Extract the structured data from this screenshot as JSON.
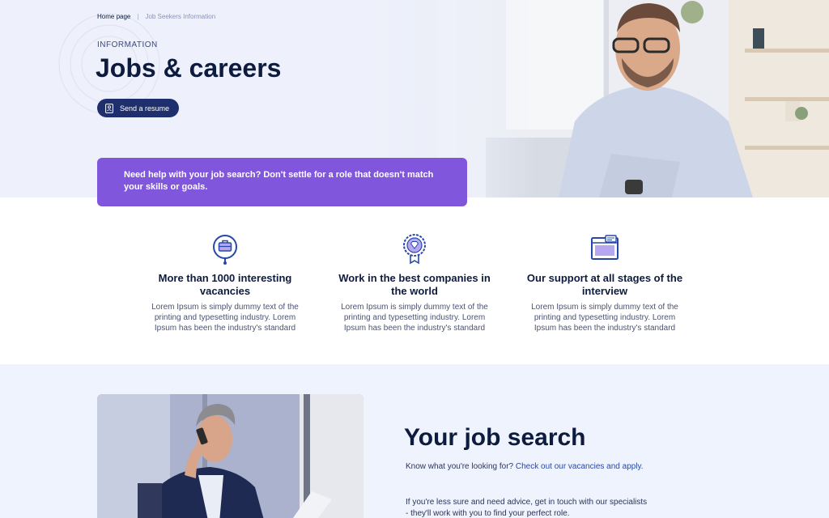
{
  "breadcrumb": {
    "home": "Home page",
    "separator": "|",
    "current": "Job Seekers Information"
  },
  "hero": {
    "eyebrow": "INFORMATION",
    "title": "Jobs & careers",
    "button_label": "Send a resume",
    "button_icon": "id-badge-icon"
  },
  "callout": {
    "text": "Need help with your job search? Don't settle for a role that doesn't match your skills or goals."
  },
  "features": [
    {
      "icon": "briefcase-pin-icon",
      "title": "More than 1000 interesting vacancies",
      "text": "Lorem Ipsum is simply dummy text of the printing and typesetting industry. Lorem Ipsum has been the industry's standard"
    },
    {
      "icon": "diamond-badge-icon",
      "title": "Work in the best companies in the world",
      "text": "Lorem Ipsum is simply dummy text of the printing and typesetting industry. Lorem Ipsum has been the industry's standard"
    },
    {
      "icon": "chat-window-icon",
      "title": "Our support at all stages of the interview",
      "text": "Lorem Ipsum is simply dummy text of the printing and typesetting industry. Lorem Ipsum has been the industry's standard"
    }
  ],
  "job_search": {
    "title": "Your job search",
    "p1_text": "Know what you're looking for?",
    "p1_link": "Check out our vacancies and apply.",
    "p2_text": "If you're less sure and need advice, get in touch with our specialists - they'll work with you to find your perfect role."
  },
  "colors": {
    "navy": "#1f2f6e",
    "purple": "#8056dc",
    "text_dark": "#0d1b3e",
    "link": "#2848a8",
    "section_bg": "#eef3fd"
  }
}
